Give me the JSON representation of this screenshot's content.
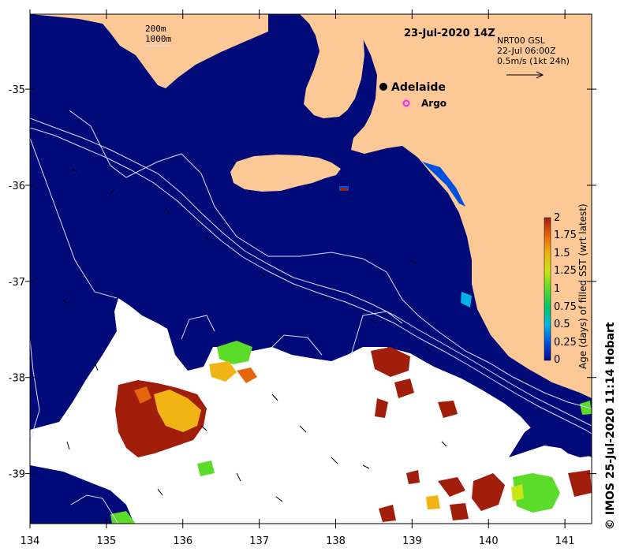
{
  "map": {
    "title": "23-Jul-2020 14Z",
    "depth_legend": [
      "200m",
      "1000m"
    ],
    "city": {
      "name": "Adelaide",
      "lon": 138.6,
      "lat": -34.93
    },
    "argo": {
      "label": "Argo",
      "lon": 138.93,
      "lat": -35.1
    },
    "current_info": [
      "NRT00 GSL",
      "22-Jul 06:00Z",
      "0.5m/s (1kt 24h)"
    ],
    "x_ticks": [
      134,
      135,
      136,
      137,
      138,
      139,
      140,
      141
    ],
    "y_ticks": [
      -35,
      -36,
      -37,
      -38,
      -39
    ],
    "lon_range": [
      134,
      141.35
    ],
    "lat_range": [
      -34.22,
      -39.52
    ],
    "colors": {
      "ocean": "#000a78",
      "land": "#fbc896",
      "no_data": "#ffffff",
      "contour": "#d8dcff",
      "arrow": "#000000",
      "argo": "#ff20ff"
    }
  },
  "colorbar": {
    "label": "Age (days) of filled SST (wrt latest)",
    "ticks": [
      "0",
      "0.25",
      "0.5",
      "0.75",
      "1",
      "1.25",
      "1.5",
      "1.75",
      "2"
    ],
    "range": [
      0,
      2
    ],
    "colors": [
      "#000a8c",
      "#0050e0",
      "#00b4e6",
      "#00c864",
      "#5adc28",
      "#c8e614",
      "#f0b414",
      "#e6640a",
      "#a01e0a"
    ]
  },
  "credit": "© IMOS 25-Jul-2020 11:14 Hobart"
}
